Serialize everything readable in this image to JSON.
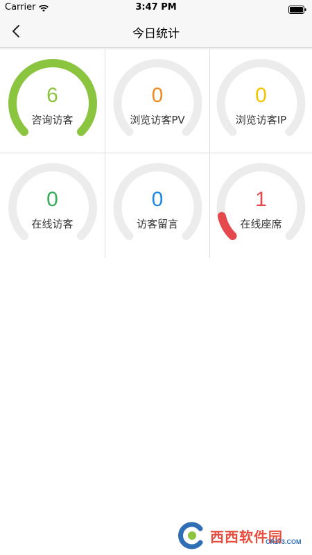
{
  "status_bar": {
    "carrier": "Carrier",
    "time": "3:47 PM"
  },
  "nav": {
    "title": "今日统计",
    "back_icon": "chevron-left-icon"
  },
  "stats": [
    {
      "value": "6",
      "label": "咨询访客",
      "color": "#8bc53f",
      "level": 1.0
    },
    {
      "value": "0",
      "label": "浏览访客PV",
      "color": "#f08c22",
      "level": 0.0
    },
    {
      "value": "0",
      "label": "浏览访客IP",
      "color": "#f5c400",
      "level": 0.0
    },
    {
      "value": "0",
      "label": "在线访客",
      "color": "#3aaa5b",
      "level": 0.0
    },
    {
      "value": "0",
      "label": "访客留言",
      "color": "#1e88e5",
      "level": 0.0
    },
    {
      "value": "1",
      "label": "在线座席",
      "color": "#e5484d",
      "level": 0.12
    }
  ],
  "gauge_track_color": "#ececec",
  "watermark": {
    "text": "西西软件园",
    "sub": "CR173.COM"
  }
}
